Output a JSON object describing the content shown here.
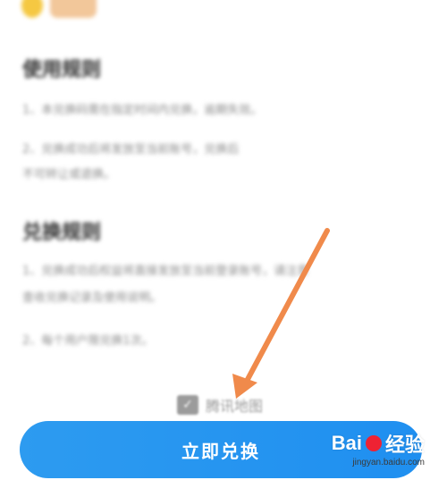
{
  "sections": [
    {
      "title": "使用规则",
      "lines": [
        "1、本兑换码需在指定时间内兑换，逾期失效。",
        "2、兑换成功后将发放至当前账号，兑换后",
        "   不可转让或退换。"
      ]
    },
    {
      "title": "兑换规则",
      "lines": [
        "1、兑换成功后权益将直接发放至当前登录账号，请注意",
        "   查收兑换记录及使用说明。",
        "2、每个用户限兑换1次。"
      ]
    }
  ],
  "footer_brand": {
    "icon": "tencent-map-logo-icon",
    "text": "腾讯地图"
  },
  "redeem_button": {
    "label": "立即兑换"
  },
  "watermark": {
    "brand": "Bai",
    "brand_suffix": "经验",
    "url": "jingyan.baidu.com"
  },
  "colors": {
    "primary": "#2196F3",
    "arrow": "#f08a4b",
    "title": "#2a2a2a",
    "body": "#8a8a8a"
  }
}
